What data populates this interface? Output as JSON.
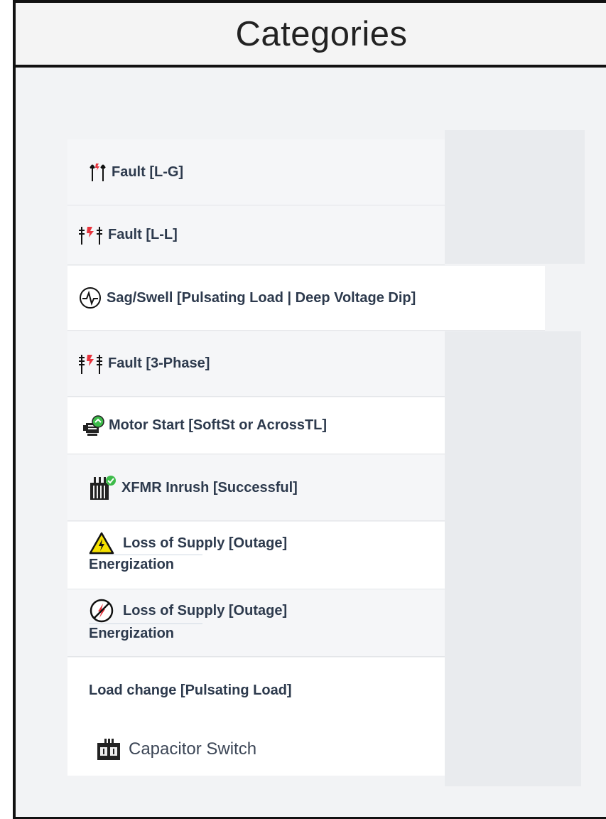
{
  "header": {
    "title": "Categories"
  },
  "categories": [
    {
      "label": "Fault [L-G]",
      "icon": "fault-lg-icon"
    },
    {
      "label": "Fault [L-L]",
      "icon": "fault-ll-icon"
    },
    {
      "label": "Sag/Swell [Pulsating Load | Deep Voltage Dip]",
      "icon": "waveform-circle-icon"
    },
    {
      "label": "Fault [3-Phase]",
      "icon": "fault-3phase-icon"
    },
    {
      "label": "Motor Start [SoftSt or AcrossTL]",
      "icon": "motor-icon"
    },
    {
      "label": "XFMR Inrush [Successful]",
      "icon": "transformer-check-icon"
    },
    {
      "label": "Loss of Supply [Outage]",
      "sublabel": "Energization",
      "icon": "warning-bolt-icon"
    },
    {
      "label": "Loss of Supply [Outage]",
      "sublabel": "Energization",
      "icon": "no-bolt-icon"
    },
    {
      "label": "Load change [Pulsating Load]"
    },
    {
      "label": "Capacitor Switch",
      "icon": "capacitor-icon"
    }
  ],
  "colors": {
    "border": "#111111",
    "text": "#2d3a4d",
    "panel_gray": "#e9ebee",
    "warning_yellow": "#f5e000",
    "fault_red": "#e8333c",
    "check_green": "#3dbb4a"
  }
}
